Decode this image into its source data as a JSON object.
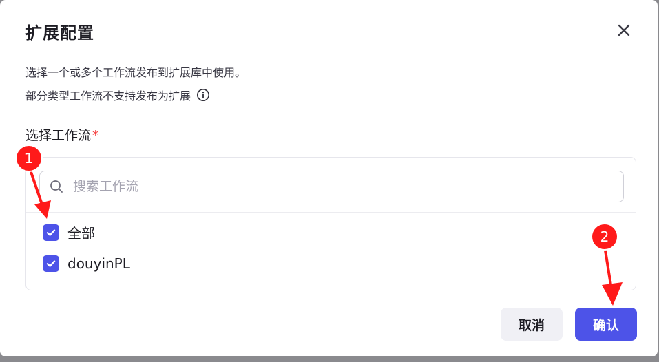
{
  "dialog": {
    "title": "扩展配置",
    "description_line1": "选择一个或多个工作流发布到扩展库中使用。",
    "description_line2": "部分类型工作流不支持发布为扩展",
    "field_label": "选择工作流",
    "required_mark": "*",
    "search": {
      "placeholder": "搜索工作流",
      "value": ""
    },
    "options": [
      {
        "label": "全部",
        "checked": true
      },
      {
        "label": "douyinPL",
        "checked": true
      }
    ],
    "buttons": {
      "cancel": "取消",
      "confirm": "确认"
    }
  },
  "annotations": {
    "marker1": "1",
    "marker2": "2"
  },
  "icons": [
    "close-icon",
    "info-icon",
    "search-icon",
    "checkmark-icon"
  ],
  "colors": {
    "accent": "#4d53e8",
    "marker": "#ff1a1a",
    "required": "#f53f3f"
  }
}
